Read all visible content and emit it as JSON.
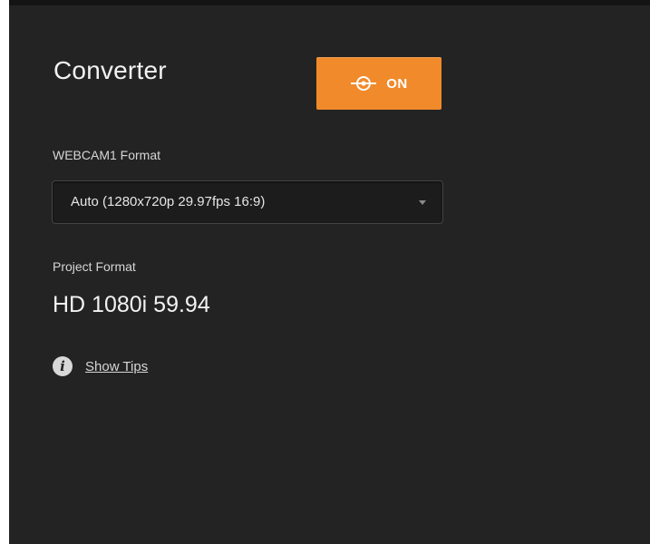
{
  "converter": {
    "title": "Converter",
    "toggle": {
      "label": "ON",
      "icon": "input-connector-icon",
      "color": "#f08a2b"
    }
  },
  "webcam_format": {
    "label": "WEBCAM1 Format",
    "selected": "Auto (1280x720p 29.97fps 16:9)"
  },
  "project_format": {
    "label": "Project Format",
    "value": "HD 1080i 59.94"
  },
  "tips": {
    "icon": "info-icon",
    "link_text": "Show Tips"
  }
}
